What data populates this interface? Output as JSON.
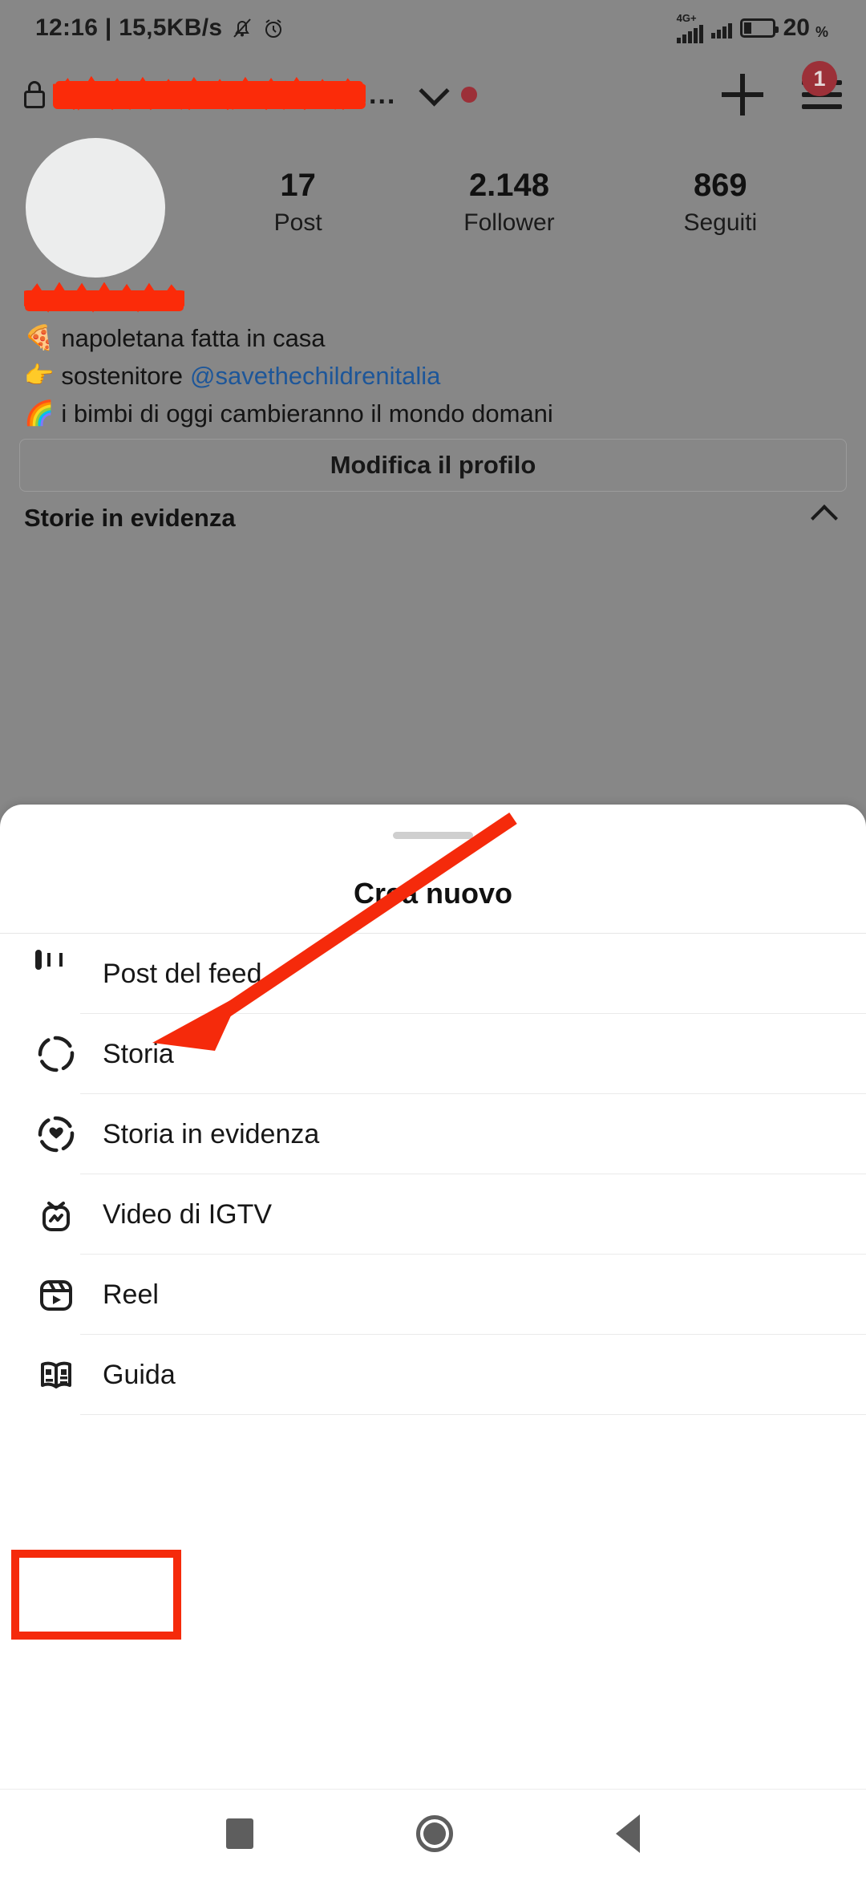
{
  "statusbar": {
    "clock": "12:16 | 15,5KB/s",
    "bell_icon": "bell-mute-icon",
    "alarm_icon": "alarm-clock-icon",
    "network_label": "4G+",
    "battery_text": "20",
    "battery_pct_symbol": "%"
  },
  "profile": {
    "lock_icon": "lock-icon",
    "username_redacted": true,
    "more_dots": "...",
    "chevron_down_icon": "chevron-down-icon",
    "notification_dot": "red-dot",
    "plus_icon": "plus-icon",
    "menu_icon": "hamburger-menu-icon",
    "menu_badge": "1",
    "stats": [
      {
        "value": "17",
        "label": "Post"
      },
      {
        "value": "2.148",
        "label": "Follower"
      },
      {
        "value": "869",
        "label": "Seguiti"
      }
    ],
    "bio": [
      {
        "emoji": "🍕",
        "text": "napoletana fatta in casa",
        "handle": ""
      },
      {
        "emoji": "👉",
        "text": "sostenitore ",
        "handle": "@savethechildrenitalia"
      },
      {
        "emoji": "🌈",
        "text": "i bimbi di oggi cambieranno il mondo domani",
        "handle": ""
      }
    ],
    "edit_profile_label": "Modifica il profilo",
    "highlights_title": "Storie in evidenza",
    "highlights_chevron": "chevron-up-icon"
  },
  "sheet": {
    "title": "Crea nuovo",
    "handle": "drag-handle",
    "items": [
      {
        "label": "Post del feed",
        "icon": "grid-icon"
      },
      {
        "label": "Storia",
        "icon": "story-circle-icon"
      },
      {
        "label": "Storia in evidenza",
        "icon": "story-highlight-heart-icon"
      },
      {
        "label": "Video di IGTV",
        "icon": "igtv-icon"
      },
      {
        "label": "Reel",
        "icon": "reel-clapperboard-icon"
      },
      {
        "label": "Guida",
        "icon": "guide-book-icon"
      }
    ]
  },
  "annotation": {
    "highlight_color": "#f52a0b",
    "arrow_color": "#f52a0b",
    "highlighted_item": "Guida"
  },
  "navbar": {
    "recents_icon": "square-recents-icon",
    "home_icon": "circle-home-icon",
    "back_icon": "triangle-back-icon"
  },
  "colors": {
    "dim_overlay": "#878787",
    "sheet_background": "#ffffff",
    "link_blue": "#1d5699",
    "badge_red": "#9c3038",
    "annotation_red": "#f52a0b"
  }
}
